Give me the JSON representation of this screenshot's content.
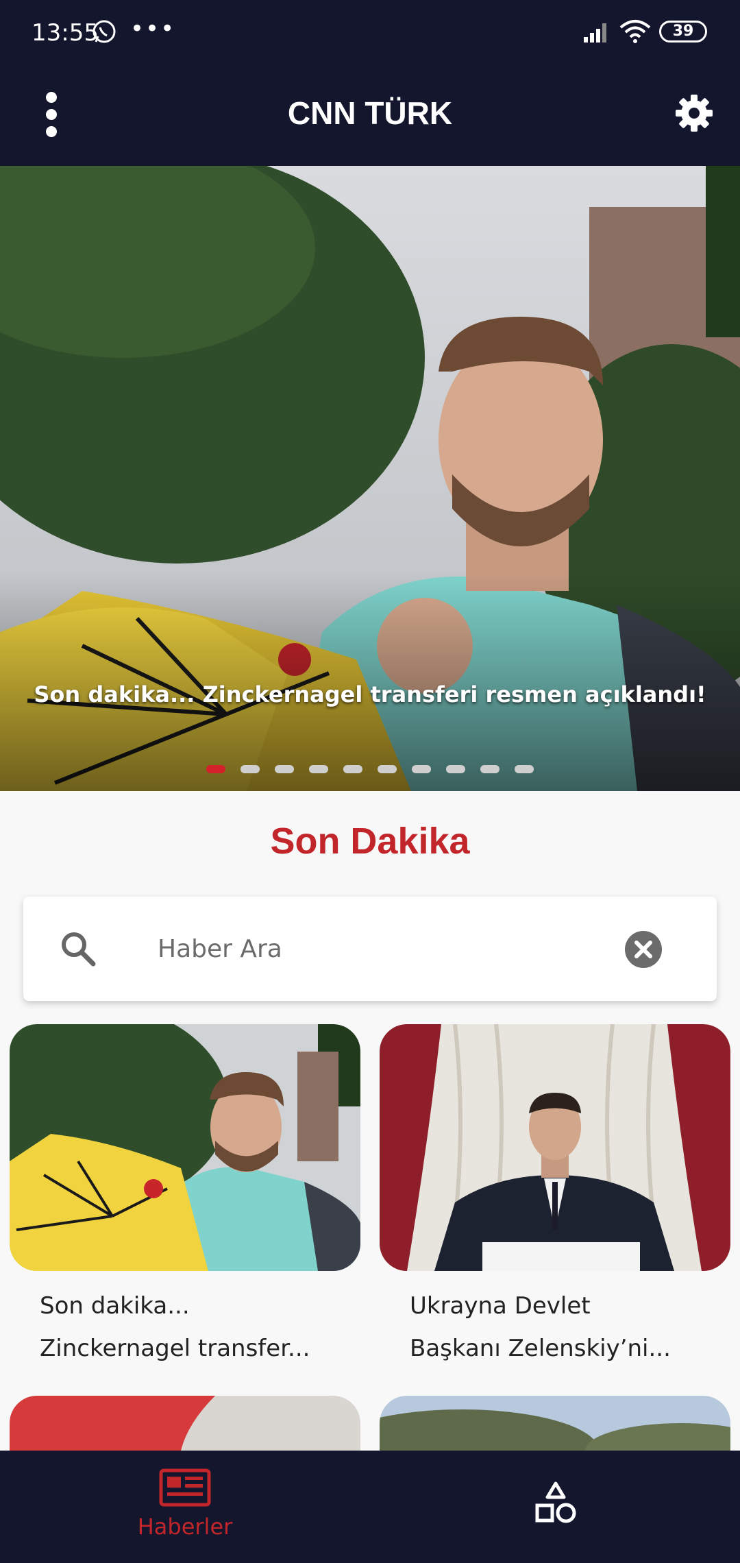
{
  "status_bar": {
    "time": "13:55",
    "more": "•••",
    "battery": "39"
  },
  "app_bar": {
    "title": "CNN TÜRK",
    "menu_icon": "more-vert-icon",
    "settings_icon": "gear-icon"
  },
  "hero": {
    "caption": "Son dakika... Zinckernagel transferi resmen açıklandı!",
    "slide_count": 10,
    "active_slide": 1
  },
  "section": {
    "title": "Son Dakika"
  },
  "search": {
    "placeholder": "Haber Ara",
    "value": ""
  },
  "news": [
    {
      "title_line1": "Son dakika...",
      "title_line2": "Zinckernagel transfer..."
    },
    {
      "title_line1": "Ukrayna Devlet",
      "title_line2": "Başkanı Zelenskiy’ni..."
    }
  ],
  "bottom_nav": {
    "items": [
      {
        "label": "Haberler",
        "icon": "newspaper-icon",
        "active": true
      },
      {
        "label": "",
        "icon": "shapes-icon",
        "active": false
      }
    ]
  },
  "colors": {
    "navy": "#14162d",
    "accent": "#c2262b",
    "background": "#f8f8f8"
  }
}
